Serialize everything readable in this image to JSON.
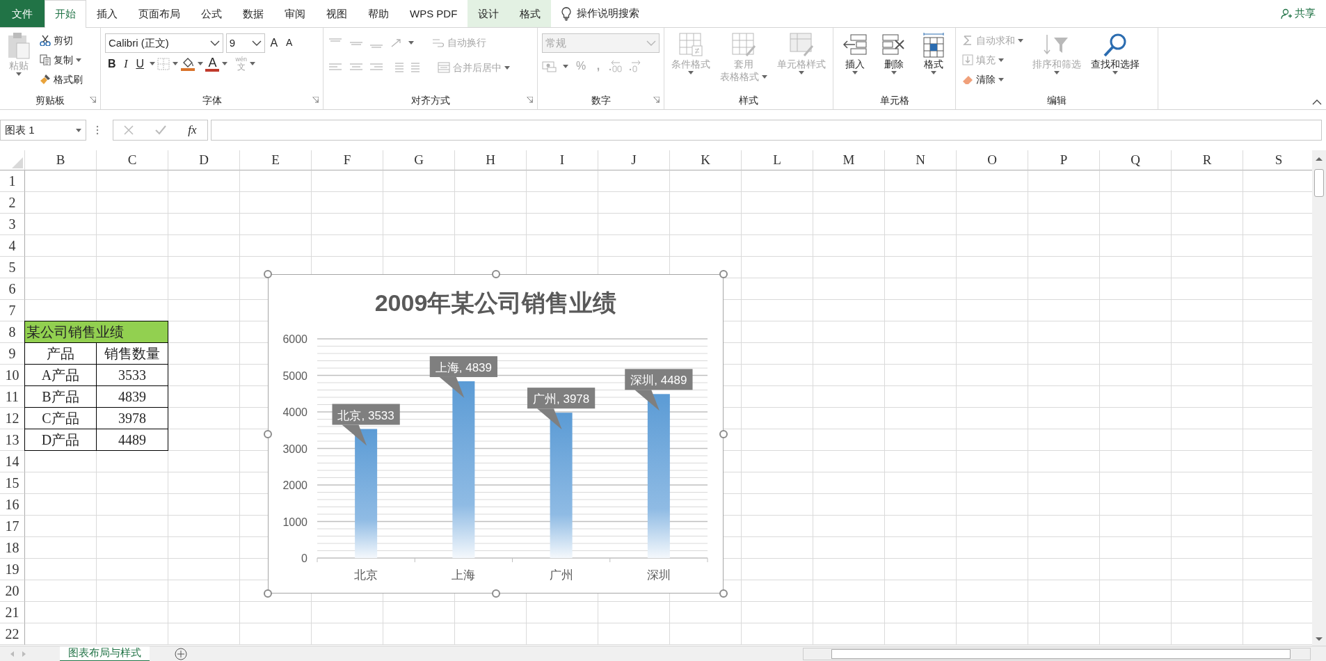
{
  "menu_tabs": [
    {
      "label": "文件",
      "kind": "file",
      "selected": false
    },
    {
      "label": "开始",
      "kind": "tab",
      "selected": true
    },
    {
      "label": "插入",
      "kind": "tab",
      "selected": false
    },
    {
      "label": "页面布局",
      "kind": "tab",
      "selected": false
    },
    {
      "label": "公式",
      "kind": "tab",
      "selected": false
    },
    {
      "label": "数据",
      "kind": "tab",
      "selected": false
    },
    {
      "label": "审阅",
      "kind": "tab",
      "selected": false
    },
    {
      "label": "视图",
      "kind": "tab",
      "selected": false
    },
    {
      "label": "帮助",
      "kind": "tab",
      "selected": false
    },
    {
      "label": "WPS PDF",
      "kind": "tab",
      "selected": false
    },
    {
      "label": "设计",
      "kind": "context",
      "selected": false
    },
    {
      "label": "格式",
      "kind": "context",
      "selected": false
    }
  ],
  "tell_me": "操作说明搜索",
  "share": "共享",
  "ribbon": [
    {
      "label": "剪贴板",
      "items": [
        {
          "label": "粘贴",
          "disabled": true
        },
        {
          "label": "剪切",
          "disabled": false
        },
        {
          "label": "复制",
          "disabled": false
        },
        {
          "label": "格式刷",
          "disabled": false
        }
      ]
    },
    {
      "label": "字体",
      "font_name": "Calibri (正文)",
      "font_size": "9",
      "grow": "A",
      "shrink": "A",
      "bold": "B",
      "italic": "I",
      "underline": "U",
      "font_color": "A",
      "phonetic_top": "wén",
      "phonetic_bottom": "文"
    },
    {
      "label": "对齐方式",
      "disabled": true,
      "wrap_text": "自动换行",
      "merge_center": "合并后居中"
    },
    {
      "label": "数字",
      "disabled": true,
      "format": "常规",
      "percent": "%",
      "comma": ","
    },
    {
      "label": "样式",
      "items": [
        {
          "label": "条件格式",
          "disabled": true
        },
        {
          "label": "套用",
          "sublabel": "表格格式",
          "disabled": true
        },
        {
          "label": "单元格样式",
          "disabled": true
        }
      ]
    },
    {
      "label": "单元格",
      "items": [
        {
          "label": "插入",
          "disabled": false
        },
        {
          "label": "删除",
          "disabled": false
        },
        {
          "label": "格式",
          "disabled": false
        }
      ]
    },
    {
      "label": "编辑",
      "items": [
        {
          "label": "自动求和",
          "disabled": true
        },
        {
          "label": "填充",
          "disabled": true
        },
        {
          "label": "清除",
          "disabled": false
        },
        {
          "label": "排序和筛选",
          "disabled": true
        },
        {
          "label": "查找和选择",
          "disabled": false
        }
      ]
    }
  ],
  "formula_bar": {
    "name_box": "图表 1",
    "fx": "fx"
  },
  "columns": [
    "B",
    "C",
    "D",
    "E",
    "F",
    "G",
    "H",
    "I",
    "J",
    "K",
    "L",
    "M",
    "N",
    "O",
    "P",
    "Q",
    "R",
    "S"
  ],
  "rows": [
    "1",
    "2",
    "3",
    "4",
    "5",
    "6",
    "7",
    "8",
    "9",
    "10",
    "11",
    "12",
    "13",
    "14",
    "15",
    "16",
    "17",
    "18",
    "19",
    "20",
    "21",
    "22"
  ],
  "table": {
    "title": "某公司销售业绩",
    "columns": [
      "产品",
      "销售数量"
    ],
    "rows": [
      [
        "A产品",
        "3533"
      ],
      [
        "B产品",
        "4839"
      ],
      [
        "C产品",
        "3978"
      ],
      [
        "D产品",
        "4489"
      ]
    ]
  },
  "chart": {
    "chart_data": {
      "type": "bar",
      "title": "2009年某公司销售业绩",
      "categories": [
        "北京",
        "上海",
        "广州",
        "深圳"
      ],
      "values": [
        3533,
        4839,
        3978,
        4489
      ],
      "ylim": [
        0,
        6000
      ],
      "grid": true,
      "yticks": [
        0,
        1000,
        2000,
        3000,
        4000,
        5000,
        6000
      ],
      "value_labels": [
        "北京, 3533",
        "上海, 4839",
        "广州, 3978",
        "深圳, 4489"
      ]
    }
  },
  "sheet_tabs": [
    {
      "label": "图表布局与样式",
      "selected": true
    }
  ]
}
